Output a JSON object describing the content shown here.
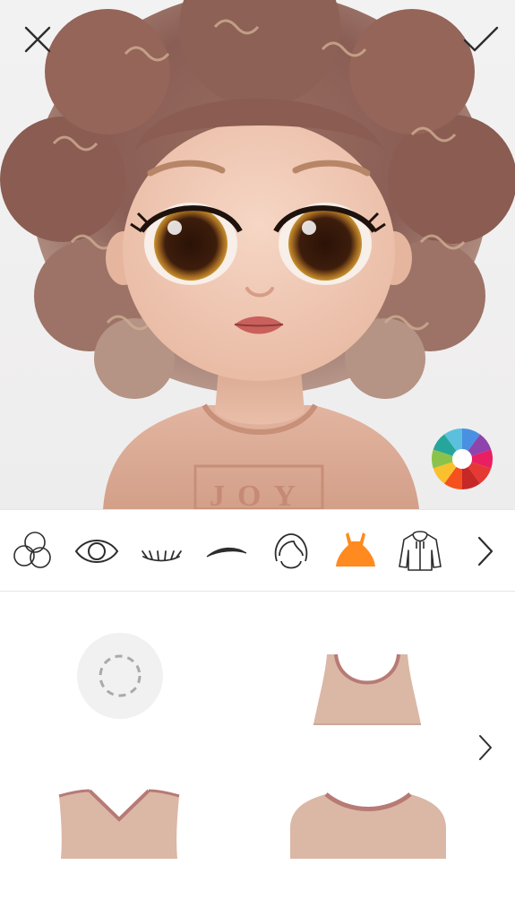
{
  "app": {
    "screen": "avatar-editor",
    "accent_color": "#ff8a1f",
    "icon_color": "#2d2d2d"
  },
  "preview": {
    "shirt_print": "JOY",
    "top_bar": {
      "close_icon": "close-icon",
      "confirm_icon": "checkmark-icon"
    },
    "color_picker_icon": "color-wheel-icon",
    "color_wheel_segments": [
      "#4a90e2",
      "#8e44ad",
      "#e91e63",
      "#e53935",
      "#c62828",
      "#f4511e",
      "#fbc02d",
      "#8bc34a",
      "#26a69a",
      "#5bc0de"
    ]
  },
  "toolbar": {
    "categories": [
      {
        "id": "skin",
        "icon": "skin-tone-icon",
        "selected": false
      },
      {
        "id": "eyes",
        "icon": "eye-icon",
        "selected": false
      },
      {
        "id": "lashes",
        "icon": "eyelashes-icon",
        "selected": false
      },
      {
        "id": "brows",
        "icon": "eyebrow-icon",
        "selected": false
      },
      {
        "id": "hair",
        "icon": "hair-icon",
        "selected": false
      },
      {
        "id": "clothes",
        "icon": "dress-icon",
        "selected": true
      },
      {
        "id": "outerwear",
        "icon": "hoodie-icon",
        "selected": false
      }
    ],
    "more_icon": "chevron-right-icon"
  },
  "options": {
    "items": [
      {
        "id": "none",
        "icon": "empty-option-icon"
      },
      {
        "id": "tank-top",
        "icon": "tank-top-icon"
      },
      {
        "id": "v-neck",
        "icon": "v-neck-icon"
      },
      {
        "id": "crew-neck",
        "icon": "crew-neck-icon"
      }
    ],
    "next_icon": "chevron-right-icon"
  }
}
